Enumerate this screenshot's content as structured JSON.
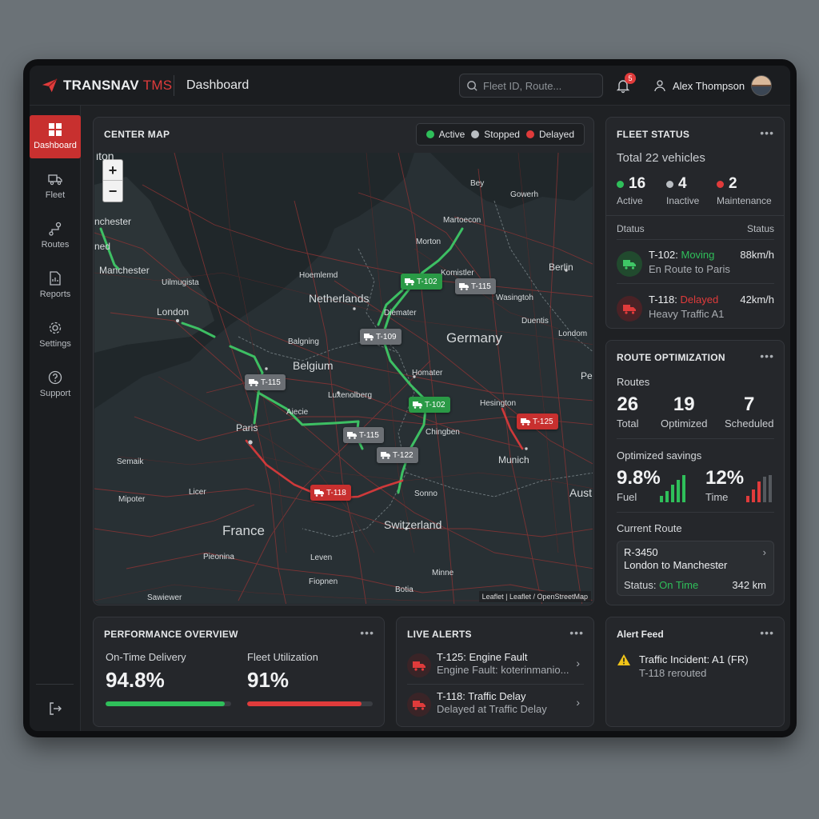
{
  "header": {
    "brand_primary": "TRANSNAV",
    "brand_secondary": "TMS",
    "page_title": "Dashboard",
    "search_placeholder": "Fleet ID, Route...",
    "notification_count": "5",
    "user_name": "Alex Thompson"
  },
  "sidebar": {
    "items": [
      {
        "label": "Dashboard",
        "icon": "grid-icon",
        "active": true
      },
      {
        "label": "Fleet",
        "icon": "truck-icon",
        "active": false
      },
      {
        "label": "Routes",
        "icon": "route-icon",
        "active": false
      },
      {
        "label": "Reports",
        "icon": "report-icon",
        "active": false
      },
      {
        "label": "Settings",
        "icon": "gear-icon",
        "active": false
      },
      {
        "label": "Support",
        "icon": "help-icon",
        "active": false
      }
    ]
  },
  "map": {
    "title": "CENTER MAP",
    "legend": [
      {
        "label": "Active",
        "color": "#2fbf5a"
      },
      {
        "label": "Stopped",
        "color": "#b9bdc2"
      },
      {
        "label": "Delayed",
        "color": "#e03b3b"
      }
    ],
    "zoom_in": "+",
    "zoom_out": "−",
    "attribution": "Leaflet | Leaflet / OpenStreetMap",
    "labels": {
      "itou": "iton",
      "manchester_top": "nchester",
      "ned": "ned",
      "manchester": "Manchester",
      "uilmugista": "Uilmugista",
      "london": "London",
      "hoemlemd": "Hoemlemd",
      "netherlands": "Netherlands",
      "martoecon": "Martoecon",
      "morton": "Morton",
      "komistler": "Komistler",
      "berlin": "Berlin",
      "diemater": "Diemater",
      "wasingtoh": "Wasingtoh",
      "duentis": "Duentis",
      "londom2": "Londom",
      "balgning": "Balgning",
      "belgium": "Belgium",
      "germany": "Germany",
      "homater": "Homater",
      "luxenolberg": "Luxenolberg",
      "aiecie": "Aiecie",
      "hesington": "Hesington",
      "pe": "Pe",
      "paris": "Paris",
      "chingben": "Chingben",
      "semaik": "Semaik",
      "munich": "Munich",
      "licer": "Licer",
      "aust": "Aust",
      "mipoter": "Mipoter",
      "sonno": "Sonno",
      "france": "France",
      "switzerland": "Switzerland",
      "pieonina": "Pieonina",
      "leven": "Leven",
      "minne": "Minne",
      "fiopnen": "Fiopnen",
      "botia": "Botia",
      "sawiewer": "Sawiewer",
      "bey": "Bey",
      "gowerh": "Gowerh"
    },
    "trucks": [
      {
        "id": "T-102",
        "status": "active"
      },
      {
        "id": "T-115",
        "status": "stopped"
      },
      {
        "id": "T-109",
        "status": "stopped"
      },
      {
        "id": "T-115",
        "status": "stopped"
      },
      {
        "id": "T-102",
        "status": "active"
      },
      {
        "id": "T-125",
        "status": "delayed"
      },
      {
        "id": "T-115",
        "status": "stopped"
      },
      {
        "id": "T-122",
        "status": "stopped"
      },
      {
        "id": "T-118",
        "status": "delayed"
      }
    ]
  },
  "fleet_status": {
    "title": "FLEET STATUS",
    "total": "Total 22 vehicles",
    "stats": [
      {
        "value": "16",
        "label": "Active",
        "color": "#2fbf5a"
      },
      {
        "value": "4",
        "label": "Inactive",
        "color": "#b9bdc2"
      },
      {
        "value": "2",
        "label": "Maintenance",
        "color": "#e03b3b"
      }
    ],
    "col_left": "Dtatus",
    "col_right": "Status",
    "vehicles": [
      {
        "id": "T-102:",
        "state": "Moving",
        "state_color": "#2fbf5a",
        "detail": "En Route to Paris",
        "speed": "88km/h"
      },
      {
        "id": "T-118:",
        "state": "Delayed",
        "state_color": "#e03b3b",
        "detail": "Heavy Traffic A1",
        "speed": "42km/h"
      }
    ]
  },
  "route_optimization": {
    "title": "ROUTE OPTIMIZATION",
    "routes_label": "Routes",
    "stats": [
      {
        "value": "26",
        "label": "Total"
      },
      {
        "value": "19",
        "label": "Optimized"
      },
      {
        "value": "7",
        "label": "Scheduled"
      }
    ],
    "savings_label": "Optimized savings",
    "fuel_value": "9.8%",
    "fuel_label": "Fuel",
    "time_value": "12%",
    "time_label": "Time",
    "current_route_label": "Current Route",
    "current_route": {
      "id": "R-3450",
      "path": "London to Manchester",
      "status_prefix": "Status:",
      "status": "On Time",
      "distance": "342 km"
    }
  },
  "performance": {
    "title": "PERFORMANCE OVERVIEW",
    "on_time_label": "On-Time Delivery",
    "on_time_value": "94.8%",
    "on_time_fraction": 0.948,
    "utilization_label": "Fleet Utilization",
    "utilization_value": "91%",
    "utilization_fraction": 0.91
  },
  "live_alerts": {
    "title": "LIVE ALERTS",
    "items": [
      {
        "title": "T-125: Engine Fault",
        "detail": "Engine Fault: koterinmanio..."
      },
      {
        "title": "T-118: Traffic Delay",
        "detail": "Delayed at Traffic Delay"
      }
    ]
  },
  "alert_feed": {
    "title": "Alert Feed",
    "item_title": "Traffic Incident: A1 (FR)",
    "item_detail": "T-118 rerouted"
  },
  "colors": {
    "accent_red": "#c8302f",
    "active_green": "#2fbf5a",
    "delayed_red": "#e03b3b"
  }
}
